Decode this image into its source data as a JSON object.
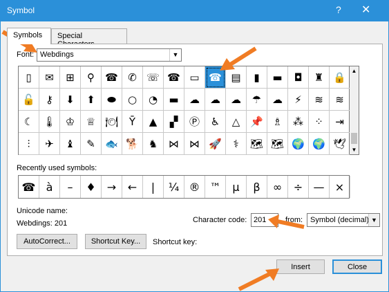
{
  "window": {
    "title": "Symbol",
    "help_glyph": "?",
    "close_glyph": "✕"
  },
  "tabs": [
    {
      "label": "Symbols",
      "active": true
    },
    {
      "label": "Special Characters",
      "active": false
    }
  ],
  "font": {
    "label": "Font:",
    "value": "Webdings"
  },
  "symbol_grid": {
    "selected_row": 0,
    "selected_col": 9,
    "rows": [
      [
        "▯",
        "✉",
        "⊞",
        "⚲",
        "☎",
        "✆",
        "☏",
        "☎",
        "▭",
        "☎",
        "▤",
        "▮",
        "▬",
        "◘",
        "♜",
        "🔒"
      ],
      [
        "🔓",
        "⚷",
        "⬇",
        "⬆",
        "⬬",
        "○",
        "◔",
        "▬",
        "☁",
        "☁",
        "☁",
        "☂",
        "☁",
        "⚡",
        "≋",
        "≋"
      ],
      [
        "☾",
        "🌡",
        "♔",
        "♕",
        "🍽",
        "Ȳ",
        "▲",
        "▞",
        "Ⓟ",
        "♿",
        "△",
        "📌",
        "♗",
        "⁂",
        "⁘",
        "⇥"
      ],
      [
        "⫶",
        "✈",
        "♝",
        "✎",
        "🐟",
        "🐕",
        "♞",
        "⋈",
        "⋈",
        "🚀",
        "⚕",
        "🗺",
        "🗺",
        "🌍",
        "🌍",
        "🕊"
      ]
    ]
  },
  "recent": {
    "label": "Recently used symbols:",
    "symbols": [
      "☎",
      "à",
      "–",
      "♦",
      "→",
      "←",
      "|",
      "¼",
      "®",
      "™",
      "µ",
      "β",
      "∞",
      "÷",
      "—",
      "×"
    ]
  },
  "unicode": {
    "name_label": "Unicode name:",
    "name_value": "Webdings: 201"
  },
  "char_code": {
    "label": "Character code:",
    "value": "201"
  },
  "from": {
    "label": "from:",
    "value": "Symbol (decimal)"
  },
  "buttons": {
    "autocorrect": "AutoCorrect...",
    "shortcut_key": "Shortcut Key...",
    "insert": "Insert",
    "close": "Close"
  },
  "shortcut_key_label": "Shortcut key:",
  "colors": {
    "accent": "#2b90d9",
    "arrow": "#f07c24"
  }
}
